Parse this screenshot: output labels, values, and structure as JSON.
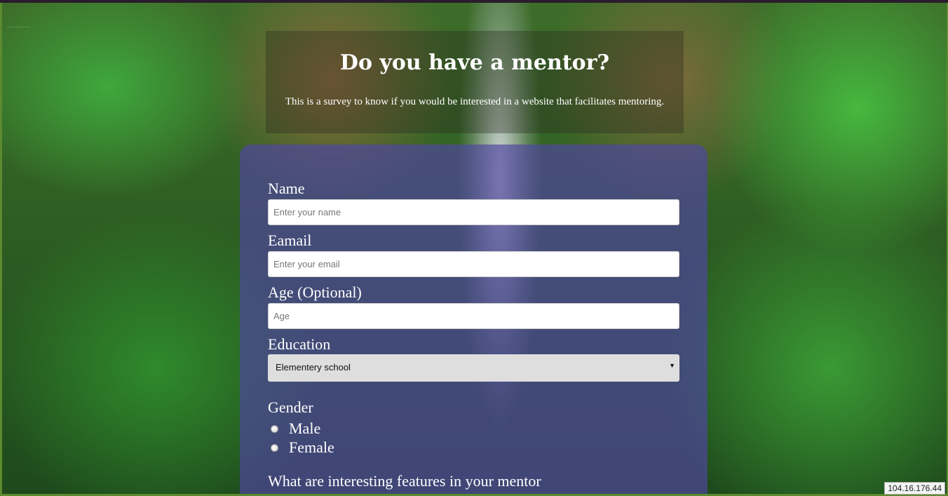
{
  "header": {
    "title": "Do you have a mentor?",
    "description": "This is a survey to know if you would be interested in a website that facilitates mentoring."
  },
  "form": {
    "name_label": "Name",
    "name_placeholder": "Enter your name",
    "email_label": "Eamail",
    "email_placeholder": "Enter your email",
    "age_label": "Age (Optional)",
    "age_placeholder": "Age",
    "education_label": "Education",
    "education_selected": "Elementery school",
    "gender_label": "Gender",
    "gender_options": [
      "Male",
      "Female"
    ],
    "features_label": "What are interesting features in your mentor"
  },
  "status": {
    "ip": "104.16.176.44"
  },
  "icons": {
    "dropdown": "chevron-down-icon"
  },
  "colors": {
    "card": "#5046a0",
    "frame_border": "#5c8a2e"
  }
}
